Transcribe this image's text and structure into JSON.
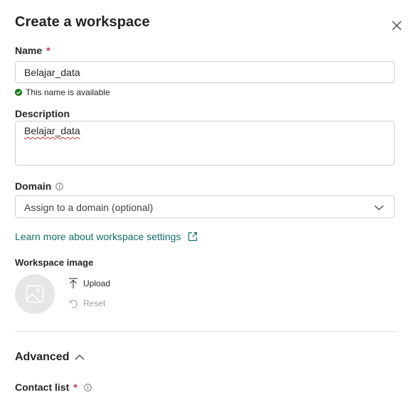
{
  "dialog": {
    "title": "Create a workspace",
    "close_label": "Close"
  },
  "name": {
    "label": "Name",
    "required_mark": "*",
    "value": "Belajar_data",
    "availability": "This name is available"
  },
  "description": {
    "label": "Description",
    "value": "Belajar_data"
  },
  "domain": {
    "label": "Domain",
    "placeholder": "Assign to a domain (optional)"
  },
  "learn_more_link": "Learn more about workspace settings",
  "workspace_image": {
    "label": "Workspace image",
    "upload_label": "Upload",
    "reset_label": "Reset"
  },
  "advanced": {
    "label": "Advanced"
  },
  "contact_list": {
    "label": "Contact list",
    "required_mark": "*"
  },
  "colors": {
    "link": "#0f6e66",
    "required": "#c4314b",
    "success": "#107c10"
  },
  "icons": [
    "close-icon",
    "checkmark-circle-icon",
    "info-icon",
    "chevron-down-icon",
    "open-external-icon",
    "image-placeholder-icon",
    "upload-icon",
    "reset-icon",
    "chevron-up-icon"
  ]
}
